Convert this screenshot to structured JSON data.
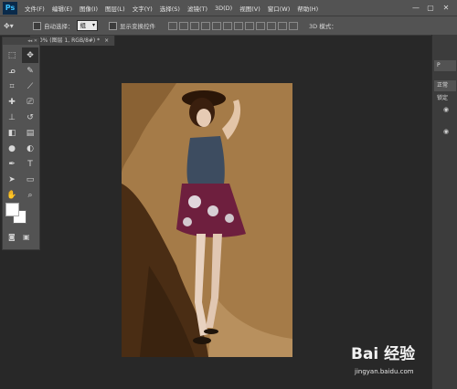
{
  "app": {
    "logo": "Ps"
  },
  "menu": [
    "文件(F)",
    "编辑(E)",
    "图像(I)",
    "图层(L)",
    "文字(Y)",
    "选择(S)",
    "滤镜(T)",
    "3D(D)",
    "视图(V)",
    "窗口(W)",
    "帮助(H)"
  ],
  "window_controls": {
    "minimize": "—",
    "restore": "▢",
    "close": "✕"
  },
  "options": {
    "auto_select_label": "自动选择：",
    "auto_select_value": "组",
    "show_transform_label": "显示变换控件",
    "mode_label": "3D 模式："
  },
  "document_tab": {
    "label": "50% (图层 1, RGB/8#) *",
    "close": "×"
  },
  "right_panel": {
    "row1": "P",
    "row2": "正常",
    "row3": "锁定"
  },
  "watermark": {
    "logo": "Bai 经验",
    "url": "jingyan.baidu.com"
  },
  "colors": {
    "ui_bg": "#535353",
    "canvas_bg": "#282828",
    "photo_bg": "#a07846",
    "fg": "#ffffff",
    "bg": "#ffffff"
  },
  "tools": [
    "move-icon",
    "marquee-icon",
    "lasso-icon",
    "quick-select-icon",
    "crop-icon",
    "eyedropper-icon",
    "healing-icon",
    "brush-icon",
    "stamp-icon",
    "history-brush-icon",
    "eraser-icon",
    "gradient-icon",
    "blur-icon",
    "dodge-icon",
    "pen-icon",
    "type-icon",
    "path-select-icon",
    "shape-icon",
    "hand-icon",
    "zoom-icon"
  ]
}
